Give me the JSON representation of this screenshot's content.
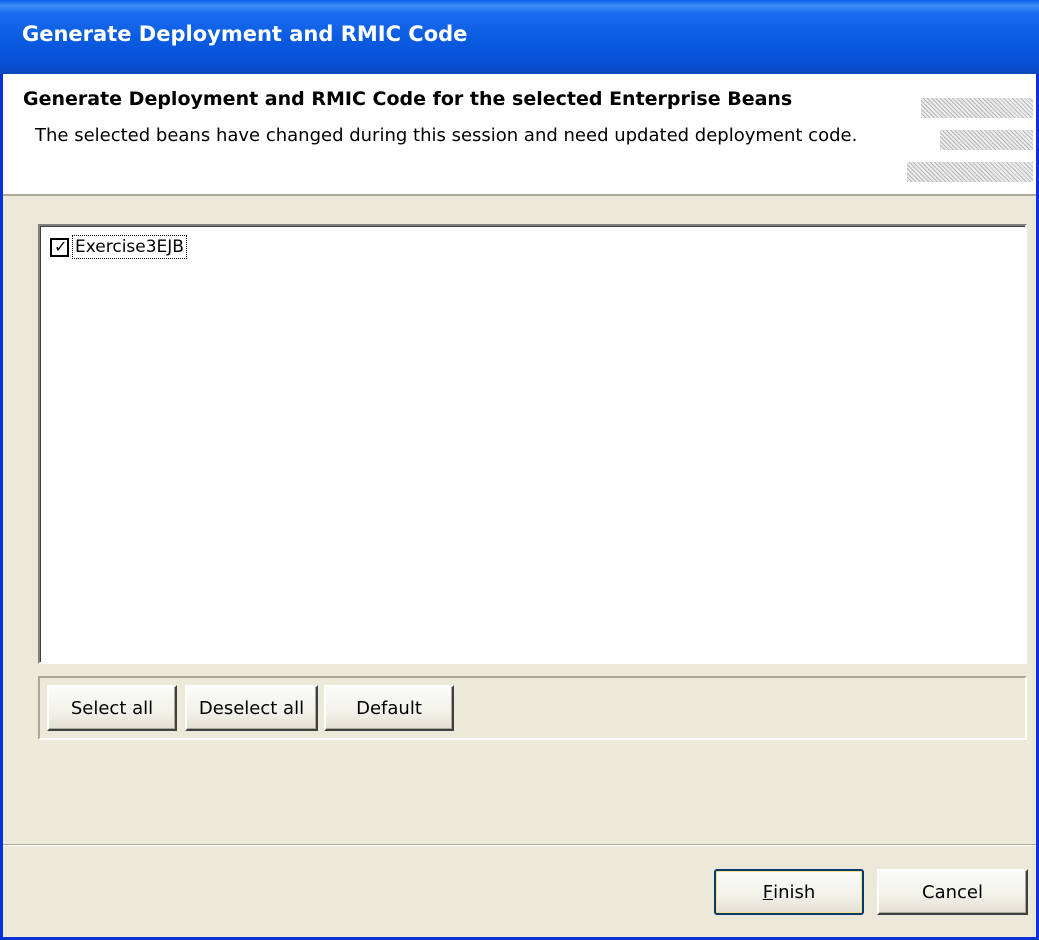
{
  "window": {
    "title": "Generate Deployment and RMIC Code"
  },
  "banner": {
    "title": "Generate Deployment and RMIC Code for the selected Enterprise Beans",
    "description": "The selected beans have changed during this session and need updated deployment code."
  },
  "bean_list": {
    "items": [
      {
        "label": "Exercise3EJB",
        "checked": true
      }
    ]
  },
  "selection_buttons": {
    "select_all": "Select all",
    "deselect_all": "Deselect all",
    "default": "Default"
  },
  "footer": {
    "finish_mnemonic": "F",
    "finish_rest": "inish",
    "cancel": "Cancel"
  },
  "colors": {
    "titlebar": "#0a5ae0",
    "face": "#ece9d8",
    "frame": "#0831d9"
  }
}
